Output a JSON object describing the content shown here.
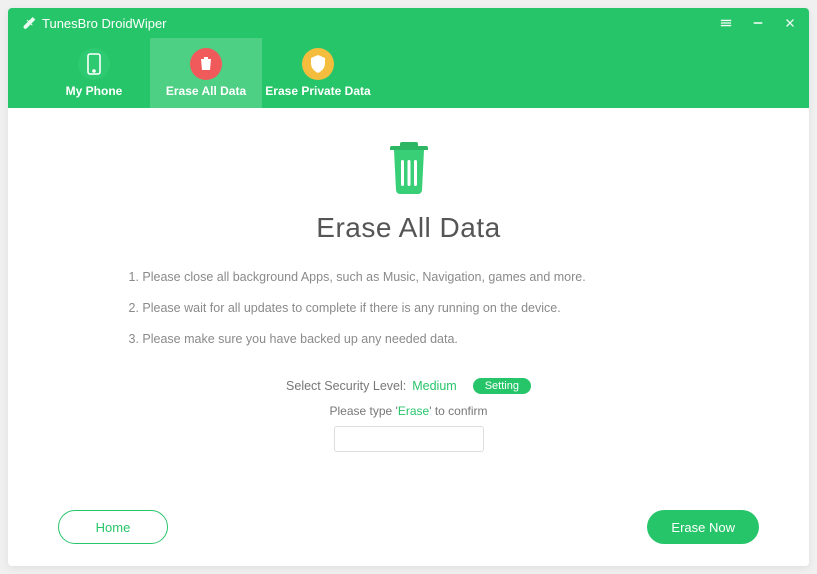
{
  "app": {
    "title": "TunesBro DroidWiper"
  },
  "tabs": {
    "myPhone": "My Phone",
    "eraseAll": "Erase All Data",
    "erasePrivate": "Erase Private Data"
  },
  "main": {
    "heading": "Erase All Data",
    "instructions": [
      "1. Please close all background Apps, such as Music, Navigation, games and more.",
      "2. Please wait for all updates to complete if there is any running on the device.",
      "3. Please make sure you have backed up any needed data."
    ],
    "securityLabel": "Select Security Level:",
    "securityLevel": "Medium",
    "settingLabel": "Setting",
    "confirmPrefix": "Please type '",
    "confirmWord": "Erase",
    "confirmSuffix": "' to confirm",
    "inputValue": ""
  },
  "footer": {
    "home": "Home",
    "eraseNow": "Erase Now"
  }
}
